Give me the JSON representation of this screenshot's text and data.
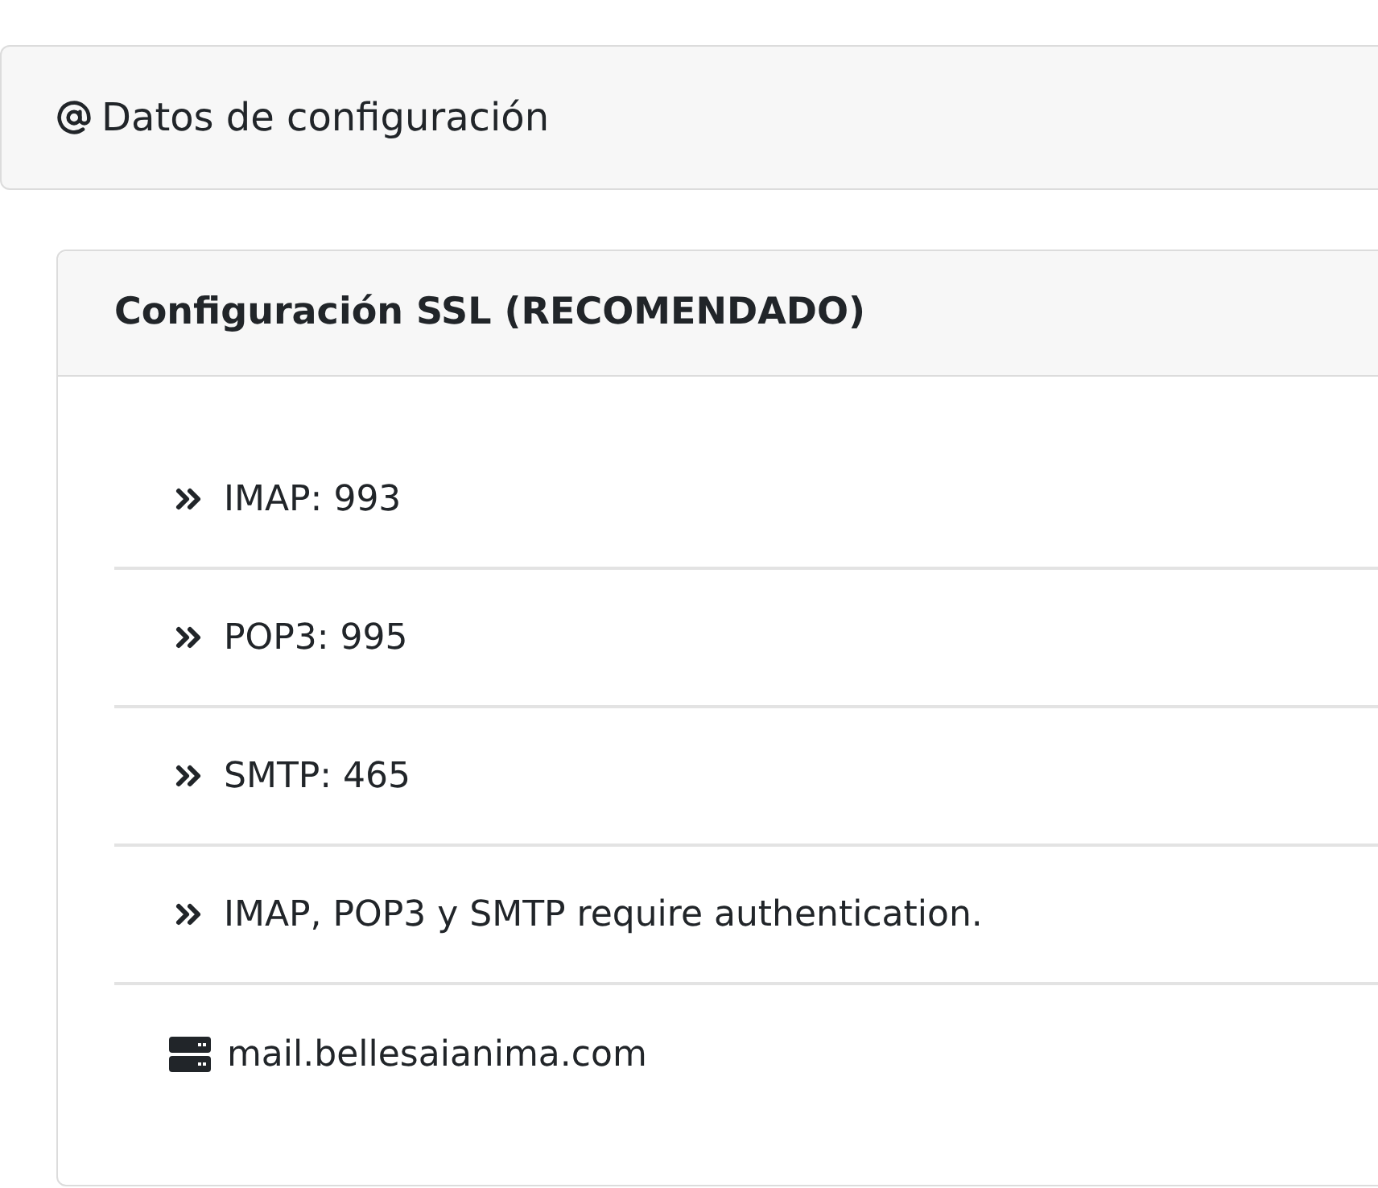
{
  "header": {
    "title": "Datos de configuración"
  },
  "card": {
    "title": "Configuración SSL (RECOMENDADO)",
    "items": [
      {
        "kind": "port",
        "text": "IMAP: 993"
      },
      {
        "kind": "port",
        "text": "POP3: 995"
      },
      {
        "kind": "port",
        "text": "SMTP: 465"
      },
      {
        "kind": "port",
        "text": "IMAP, POP3 y SMTP require authentication."
      },
      {
        "kind": "server",
        "text": "mail.bellesaianima.com"
      }
    ]
  }
}
